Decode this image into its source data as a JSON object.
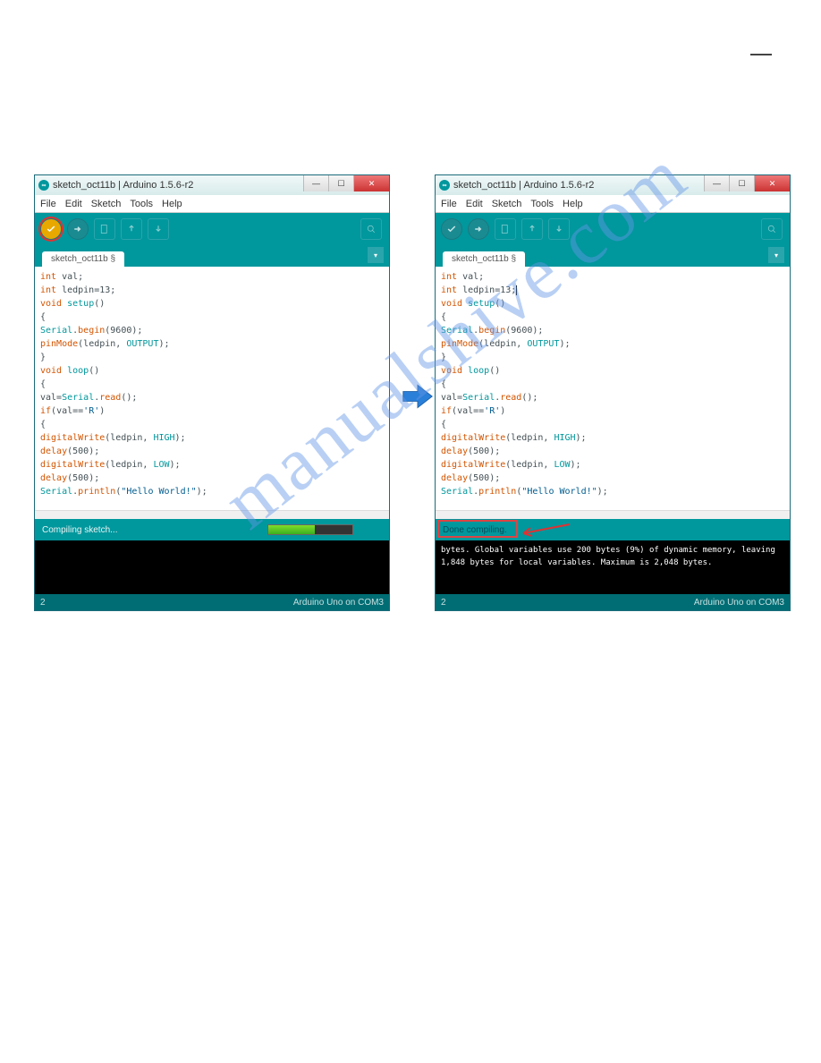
{
  "watermark": "manualshive.com",
  "windows": {
    "left": {
      "title": "sketch_oct11b | Arduino 1.5.6-r2",
      "menu": [
        "File",
        "Edit",
        "Sketch",
        "Tools",
        "Help"
      ],
      "tab": "sketch_oct11b §",
      "code": [
        [
          {
            "t": "kw",
            "v": "int"
          },
          {
            "t": "plain",
            "v": " val;"
          }
        ],
        [
          {
            "t": "kw",
            "v": "int"
          },
          {
            "t": "plain",
            "v": " ledpin=13;"
          }
        ],
        [
          {
            "t": "kw",
            "v": "void"
          },
          {
            "t": "plain",
            "v": " "
          },
          {
            "t": "type",
            "v": "setup"
          },
          {
            "t": "plain",
            "v": "()"
          }
        ],
        [
          {
            "t": "plain",
            "v": "{"
          }
        ],
        [
          {
            "t": "type",
            "v": "Serial"
          },
          {
            "t": "plain",
            "v": "."
          },
          {
            "t": "fn",
            "v": "begin"
          },
          {
            "t": "plain",
            "v": "(9600);"
          }
        ],
        [
          {
            "t": "fn",
            "v": "pinMode"
          },
          {
            "t": "plain",
            "v": "(ledpin, "
          },
          {
            "t": "type",
            "v": "OUTPUT"
          },
          {
            "t": "plain",
            "v": ");"
          }
        ],
        [
          {
            "t": "plain",
            "v": "}"
          }
        ],
        [
          {
            "t": "kw",
            "v": "void"
          },
          {
            "t": "plain",
            "v": " "
          },
          {
            "t": "type",
            "v": "loop"
          },
          {
            "t": "plain",
            "v": "()"
          }
        ],
        [
          {
            "t": "plain",
            "v": "{"
          }
        ],
        [
          {
            "t": "plain",
            "v": "val="
          },
          {
            "t": "type",
            "v": "Serial"
          },
          {
            "t": "plain",
            "v": "."
          },
          {
            "t": "fn",
            "v": "read"
          },
          {
            "t": "plain",
            "v": "();"
          }
        ],
        [
          {
            "t": "kw",
            "v": "if"
          },
          {
            "t": "plain",
            "v": "(val=="
          },
          {
            "t": "str",
            "v": "'R'"
          },
          {
            "t": "plain",
            "v": ")"
          }
        ],
        [
          {
            "t": "plain",
            "v": "{"
          }
        ],
        [
          {
            "t": "fn",
            "v": "digitalWrite"
          },
          {
            "t": "plain",
            "v": "(ledpin, "
          },
          {
            "t": "type",
            "v": "HIGH"
          },
          {
            "t": "plain",
            "v": ");"
          }
        ],
        [
          {
            "t": "fn",
            "v": "delay"
          },
          {
            "t": "plain",
            "v": "(500);"
          }
        ],
        [
          {
            "t": "fn",
            "v": "digitalWrite"
          },
          {
            "t": "plain",
            "v": "(ledpin, "
          },
          {
            "t": "type",
            "v": "LOW"
          },
          {
            "t": "plain",
            "v": ");"
          }
        ],
        [
          {
            "t": "fn",
            "v": "delay"
          },
          {
            "t": "plain",
            "v": "(500);"
          }
        ],
        [
          {
            "t": "type",
            "v": "Serial"
          },
          {
            "t": "plain",
            "v": "."
          },
          {
            "t": "fn",
            "v": "println"
          },
          {
            "t": "plain",
            "v": "("
          },
          {
            "t": "str",
            "v": "\"Hello World!\""
          },
          {
            "t": "plain",
            "v": ");"
          }
        ]
      ],
      "status": "Compiling sketch...",
      "console": "",
      "footer_left": "2",
      "footer_right": "Arduino Uno on COM3"
    },
    "right": {
      "title": "sketch_oct11b | Arduino 1.5.6-r2",
      "menu": [
        "File",
        "Edit",
        "Sketch",
        "Tools",
        "Help"
      ],
      "tab": "sketch_oct11b §",
      "code": [
        [
          {
            "t": "kw",
            "v": "int"
          },
          {
            "t": "plain",
            "v": " val;"
          }
        ],
        [
          {
            "t": "kw",
            "v": "int"
          },
          {
            "t": "plain",
            "v": " ledpin=13;"
          },
          {
            "t": "cursor",
            "v": ""
          }
        ],
        [
          {
            "t": "kw",
            "v": "void"
          },
          {
            "t": "plain",
            "v": " "
          },
          {
            "t": "type",
            "v": "setup"
          },
          {
            "t": "plain",
            "v": "()"
          }
        ],
        [
          {
            "t": "plain",
            "v": "{"
          }
        ],
        [
          {
            "t": "type",
            "v": "Serial"
          },
          {
            "t": "plain",
            "v": "."
          },
          {
            "t": "fn",
            "v": "begin"
          },
          {
            "t": "plain",
            "v": "(9600);"
          }
        ],
        [
          {
            "t": "fn",
            "v": "pinMode"
          },
          {
            "t": "plain",
            "v": "(ledpin, "
          },
          {
            "t": "type",
            "v": "OUTPUT"
          },
          {
            "t": "plain",
            "v": ");"
          }
        ],
        [
          {
            "t": "plain",
            "v": "}"
          }
        ],
        [
          {
            "t": "kw",
            "v": "void"
          },
          {
            "t": "plain",
            "v": " "
          },
          {
            "t": "type",
            "v": "loop"
          },
          {
            "t": "plain",
            "v": "()"
          }
        ],
        [
          {
            "t": "plain",
            "v": "{"
          }
        ],
        [
          {
            "t": "plain",
            "v": "val="
          },
          {
            "t": "type",
            "v": "Serial"
          },
          {
            "t": "plain",
            "v": "."
          },
          {
            "t": "fn",
            "v": "read"
          },
          {
            "t": "plain",
            "v": "();"
          }
        ],
        [
          {
            "t": "kw",
            "v": "if"
          },
          {
            "t": "plain",
            "v": "(val=="
          },
          {
            "t": "str",
            "v": "'R'"
          },
          {
            "t": "plain",
            "v": ")"
          }
        ],
        [
          {
            "t": "plain",
            "v": "{"
          }
        ],
        [
          {
            "t": "fn",
            "v": "digitalWrite"
          },
          {
            "t": "plain",
            "v": "(ledpin, "
          },
          {
            "t": "type",
            "v": "HIGH"
          },
          {
            "t": "plain",
            "v": ");"
          }
        ],
        [
          {
            "t": "fn",
            "v": "delay"
          },
          {
            "t": "plain",
            "v": "(500);"
          }
        ],
        [
          {
            "t": "fn",
            "v": "digitalWrite"
          },
          {
            "t": "plain",
            "v": "(ledpin, "
          },
          {
            "t": "type",
            "v": "LOW"
          },
          {
            "t": "plain",
            "v": ");"
          }
        ],
        [
          {
            "t": "fn",
            "v": "delay"
          },
          {
            "t": "plain",
            "v": "(500);"
          }
        ],
        [
          {
            "t": "type",
            "v": "Serial"
          },
          {
            "t": "plain",
            "v": "."
          },
          {
            "t": "fn",
            "v": "println"
          },
          {
            "t": "plain",
            "v": "("
          },
          {
            "t": "str",
            "v": "\"Hello World!\""
          },
          {
            "t": "plain",
            "v": ");"
          }
        ]
      ],
      "status": "Done compiling.",
      "console": "bytes.\nGlobal variables use 200 bytes (9%) of dynamic memory, leaving 1,848 bytes for local variables. Maximum is 2,048 bytes.",
      "footer_left": "2",
      "footer_right": "Arduino Uno on COM3"
    }
  }
}
